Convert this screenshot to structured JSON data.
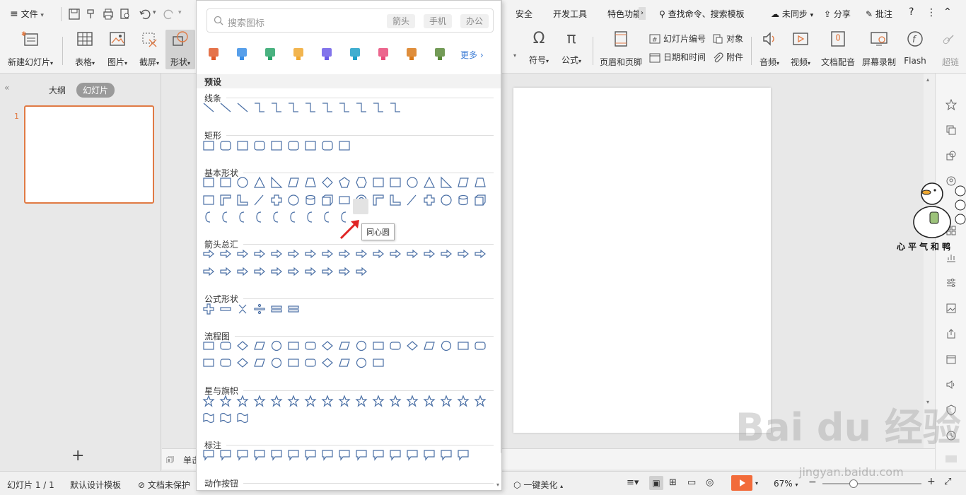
{
  "menu": {
    "file": "文件",
    "tabs": [
      "安全",
      "开发工具",
      "特色功能"
    ],
    "search": "查找命令、搜索模板",
    "sync": "未同步",
    "share": "分享",
    "comment": "批注"
  },
  "ribbon_left": {
    "new_slide": "新建幻灯片",
    "table": "表格",
    "image": "图片",
    "screenshot": "截屏",
    "shape": "形状"
  },
  "ribbon_right": {
    "symbol": "符号",
    "formula": "公式",
    "header_footer": "页眉和页脚",
    "slide_number": "幻灯片编号",
    "object": "对象",
    "date_time": "日期和时间",
    "attachment": "附件",
    "audio": "音频",
    "video": "视频",
    "doc_audio": "文档配音",
    "screen_record": "屏幕录制",
    "flash": "Flash",
    "super": "超链"
  },
  "left_panel": {
    "outline_tab": "大纲",
    "slides_tab": "幻灯片",
    "slide_index": "1",
    "add": "+"
  },
  "notes": {
    "label": "单击"
  },
  "status": {
    "slide_count": "幻灯片 1 / 1",
    "template": "默认设计模板",
    "protect": "文档未保护",
    "beautify": "一键美化",
    "zoom": "67%",
    "minus": "−",
    "plus": "+"
  },
  "shape_panel": {
    "search_placeholder": "搜索图标",
    "tags": [
      "箭头",
      "手机",
      "办公"
    ],
    "more": "更多",
    "preset": "预设",
    "categories": [
      "线条",
      "矩形",
      "基本形状",
      "箭头总汇",
      "公式形状",
      "流程图",
      "星与旗帜",
      "标注",
      "动作按钮"
    ],
    "tooltip": "同心圆"
  },
  "watermark": {
    "baidu": "Bai du 经验",
    "url": "jingyan.baidu.com",
    "duck_text": "心平气和鸭"
  },
  "colors": {
    "accent": "#e07a44",
    "shape_stroke": "#4a6fa5",
    "play": "#f26b3a"
  }
}
